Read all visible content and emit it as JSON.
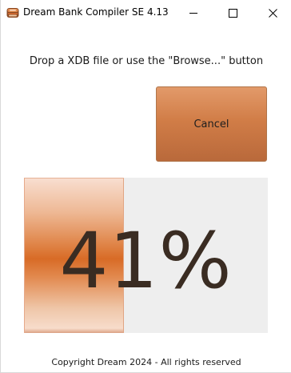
{
  "window": {
    "title": "Dream Bank Compiler SE 4.13",
    "icon": "app-logo-icon",
    "controls": {
      "minimize_icon": "minimize-icon",
      "maximize_icon": "maximize-icon",
      "close_icon": "close-icon"
    }
  },
  "main": {
    "instruction": "Drop a XDB file or use the \"Browse...\" button",
    "cancel_label": "Cancel",
    "progress": {
      "value": 41,
      "label": "41%"
    },
    "copyright": "Copyright Dream 2024 - All rights reserved"
  },
  "colors": {
    "accent": "#d17d47",
    "progress_fill": "#d86b26",
    "progress_track": "#eeeeee",
    "progress_text": "#3a2c22"
  }
}
